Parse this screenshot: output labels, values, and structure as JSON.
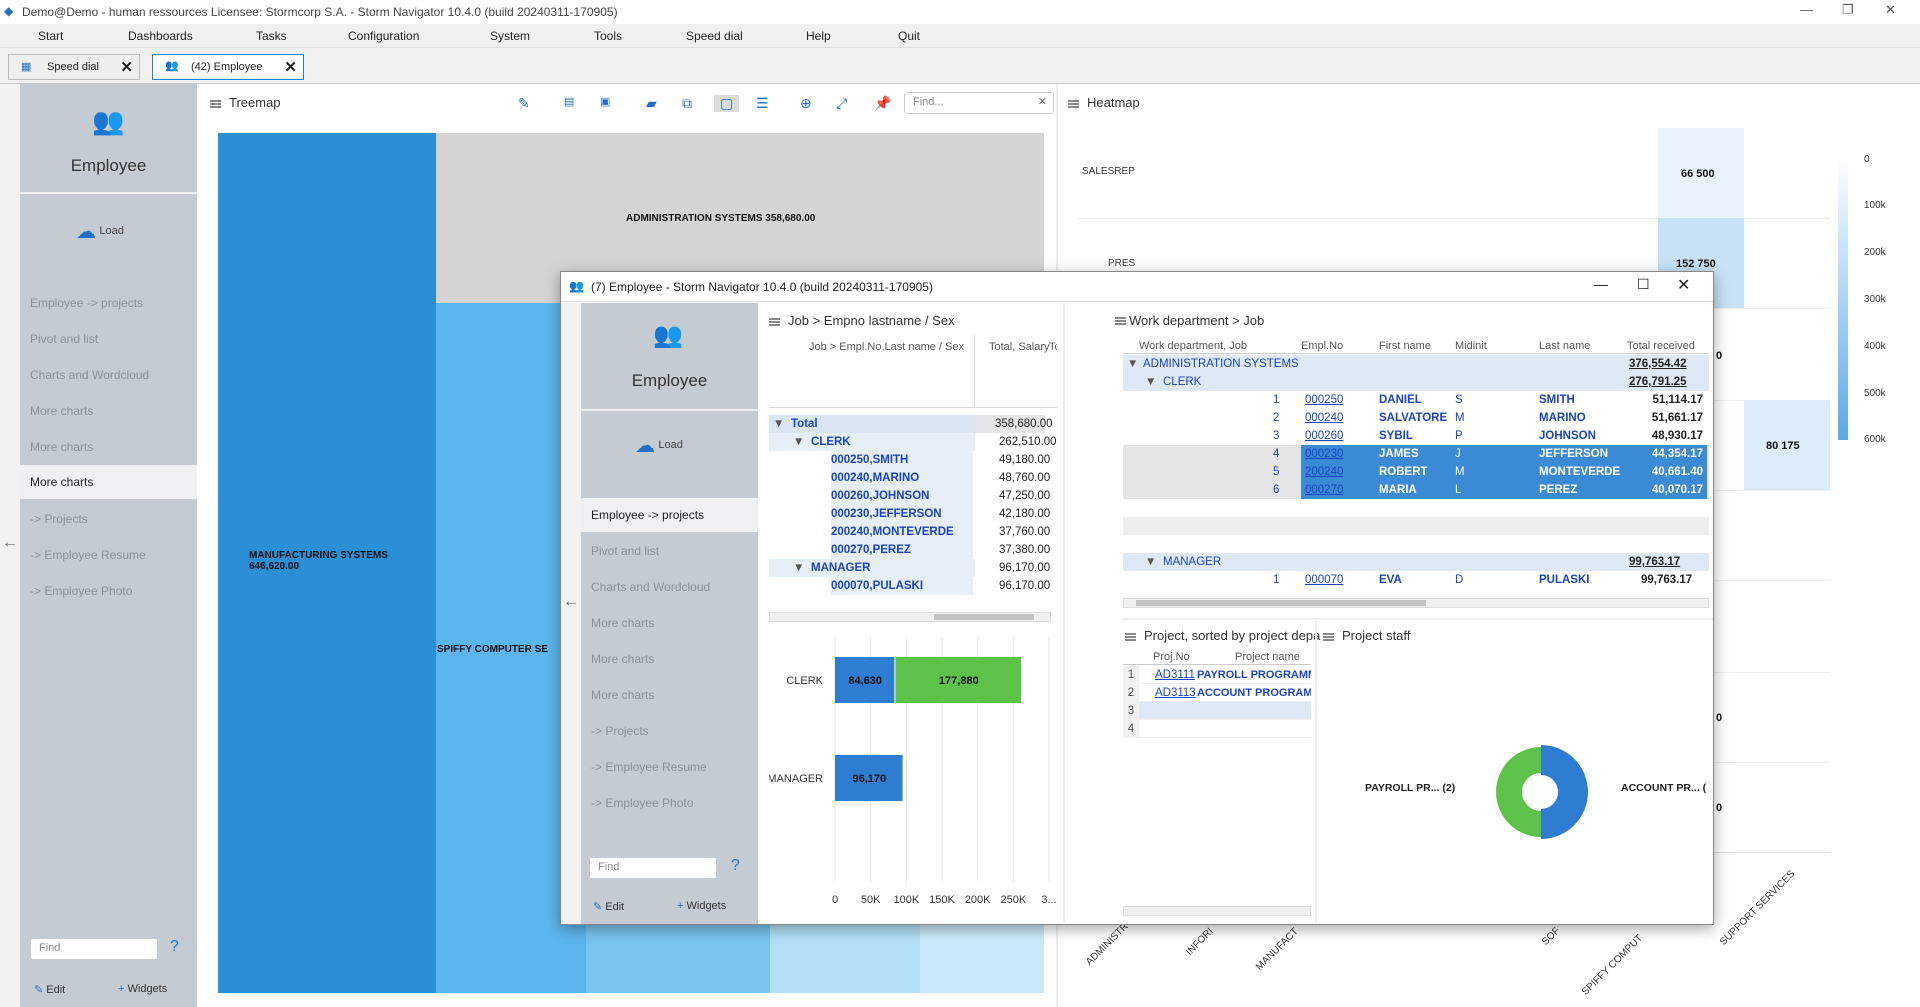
{
  "titlebar": {
    "title": "Demo@Demo - human ressources    Licensee: Stormcorp S.A. -  Storm Navigator 10.4.0 (build 20240311-170905)"
  },
  "menu": [
    "Start",
    "Dashboards",
    "Tasks",
    "Configuration",
    "System",
    "Tools",
    "Speed dial",
    "Help",
    "Quit"
  ],
  "tabs": [
    {
      "label": "Speed dial"
    },
    {
      "label": "(42) Employee"
    }
  ],
  "sidebar": {
    "title": "Employee",
    "load": "Load",
    "items": [
      "Employee -> projects",
      "Pivot and list",
      "Charts and Wordcloud",
      "More charts",
      "More charts",
      "More charts",
      "-> Projects",
      "-> Employee Resume",
      "-> Employee Photo"
    ],
    "find_placeholder": "Find",
    "help": "?",
    "edit": "Edit",
    "widgets": "Widgets"
  },
  "treemap": {
    "title": "Treemap",
    "find_placeholder": "Find...",
    "cells": [
      {
        "label": "ADMINISTRATION SYSTEMS 358,680.00"
      },
      {
        "label": "MANUFACTURING SYSTEMS",
        "value": "646,620.00"
      },
      {
        "label": "SPIFFY COMPUTER SE"
      }
    ]
  },
  "heatmap": {
    "title": "Heatmap",
    "rows": [
      "SALESREP",
      "PRES"
    ],
    "values": [
      "66 500",
      "152 750",
      "80 175",
      "0",
      "0",
      "0"
    ],
    "legend": [
      "0",
      "100k",
      "200k",
      "300k",
      "400k",
      "500k",
      "600k"
    ],
    "xlabels": [
      "ADMINISTR",
      "INFORI",
      "MANUFACT",
      "SOF",
      "SPIFFY COMPUT",
      "SUPPORT SERVICES"
    ]
  },
  "dialog": {
    "title": "(7) Employee -  Storm Navigator 10.4.0 (build 20240311-170905)",
    "sidebar": {
      "title": "Employee",
      "load": "Load",
      "items": [
        "Employee -> projects",
        "Pivot and list",
        "Charts and Wordcloud",
        "More charts",
        "More charts",
        "More charts",
        "-> Projects",
        "-> Employee Resume",
        "-> Employee Photo"
      ],
      "find_placeholder": "Find",
      "help": "?",
      "edit": "Edit",
      "widgets": "Widgets"
    },
    "pivot": {
      "title": "Job > Empno lastname / Sex",
      "col1": "Job > Empl.No,Last name / Sex",
      "col2": "Total, Salary",
      "col3": "Tc",
      "rows": [
        {
          "label": "Total",
          "value": "358,680.00"
        },
        {
          "label": "CLERK",
          "value": "262,510.00"
        },
        {
          "label": "000250,SMITH",
          "value": "49,180.00"
        },
        {
          "label": "000240,MARINO",
          "value": "48,760.00"
        },
        {
          "label": "000260,JOHNSON",
          "value": "47,250.00"
        },
        {
          "label": "000230,JEFFERSON",
          "value": "42,180.00"
        },
        {
          "label": "200240,MONTEVERDE",
          "value": "37,760.00"
        },
        {
          "label": "000270,PEREZ",
          "value": "37,380.00"
        },
        {
          "label": "MANAGER",
          "value": "96,170.00"
        },
        {
          "label": "000070,PULASKI",
          "value": "96,170.00"
        }
      ]
    },
    "grid": {
      "title": "Work department > Job",
      "headers": [
        "Work department, Job",
        "Empl.No",
        "First name",
        "Midinit",
        "Last name",
        "Total received"
      ],
      "dept": {
        "label": "ADMINISTRATION SYSTEMS",
        "total": "376,554.42"
      },
      "clerk": {
        "label": "CLERK",
        "total": "276,791.25"
      },
      "rows": [
        {
          "n": "1",
          "empno": "000250",
          "first": "DANIEL",
          "mid": "S",
          "last": "SMITH",
          "total": "51,114.17"
        },
        {
          "n": "2",
          "empno": "000240",
          "first": "SALVATORE",
          "mid": "M",
          "last": "MARINO",
          "total": "51,661.17"
        },
        {
          "n": "3",
          "empno": "000260",
          "first": "SYBIL",
          "mid": "P",
          "last": "JOHNSON",
          "total": "48,930.17"
        },
        {
          "n": "4",
          "empno": "000230",
          "first": "JAMES",
          "mid": "J",
          "last": "JEFFERSON",
          "total": "44,354.17"
        },
        {
          "n": "5",
          "empno": "200240",
          "first": "ROBERT",
          "mid": "M",
          "last": "MONTEVERDE",
          "total": "40,661.40"
        },
        {
          "n": "6",
          "empno": "000270",
          "first": "MARIA",
          "mid": "L",
          "last": "PEREZ",
          "total": "40,070.17"
        }
      ],
      "manager": {
        "label": "MANAGER",
        "total": "99,763.17"
      },
      "mgr_rows": [
        {
          "n": "1",
          "empno": "000070",
          "first": "EVA",
          "mid": "D",
          "last": "PULASKI",
          "total": "99,763.17"
        }
      ]
    },
    "projects": {
      "title": "Project, sorted by project depa",
      "headers": [
        "Proj.No",
        "Project name"
      ],
      "rows": [
        {
          "n": "1",
          "no": "AD3111",
          "name": "PAYROLL PROGRAMMIN"
        },
        {
          "n": "2",
          "no": "AD3113",
          "name": "ACCOUNT PROGRAMMIN"
        },
        {
          "n": "3",
          "no": "",
          "name": ""
        },
        {
          "n": "4",
          "no": "",
          "name": ""
        }
      ]
    },
    "staff": {
      "title": "Project staff",
      "left_label": "PAYROLL PR... (2)",
      "right_label": "ACCOUNT PR... ("
    }
  },
  "chart_data": {
    "type": "bar",
    "stacked": true,
    "orientation": "horizontal",
    "categories": [
      "CLERK",
      "MANAGER"
    ],
    "series": [
      {
        "values": [
          84630,
          96170
        ],
        "color": "#2e7dd2"
      },
      {
        "values": [
          177880,
          0
        ],
        "color": "#5cc24a"
      }
    ],
    "xticks": [
      "0",
      "50K",
      "100K",
      "150K",
      "200K",
      "250K",
      "3..."
    ],
    "xlim": [
      0,
      300000
    ]
  }
}
